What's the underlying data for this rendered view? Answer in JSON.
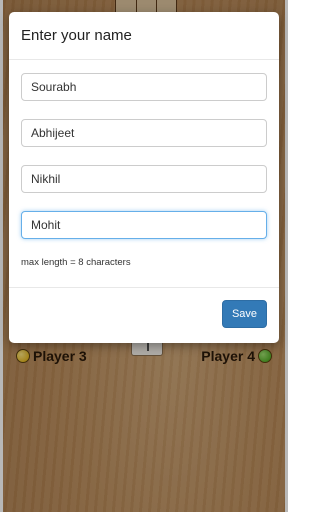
{
  "background": {
    "players": [
      {
        "name": "Player 3",
        "token_color": "#d7a400"
      },
      {
        "name": "Player 4",
        "token_color": "#3a9a10"
      }
    ]
  },
  "modal": {
    "title": "Enter your name",
    "inputs": [
      {
        "value": "Sourabh"
      },
      {
        "value": "Abhijeet"
      },
      {
        "value": "Nikhil"
      },
      {
        "value": "Mohit",
        "focused": true
      }
    ],
    "hint": "max length = 8 characters",
    "save_label": "Save"
  },
  "colors": {
    "primary_button": "#337ab7",
    "focus_border": "#66afe9"
  }
}
